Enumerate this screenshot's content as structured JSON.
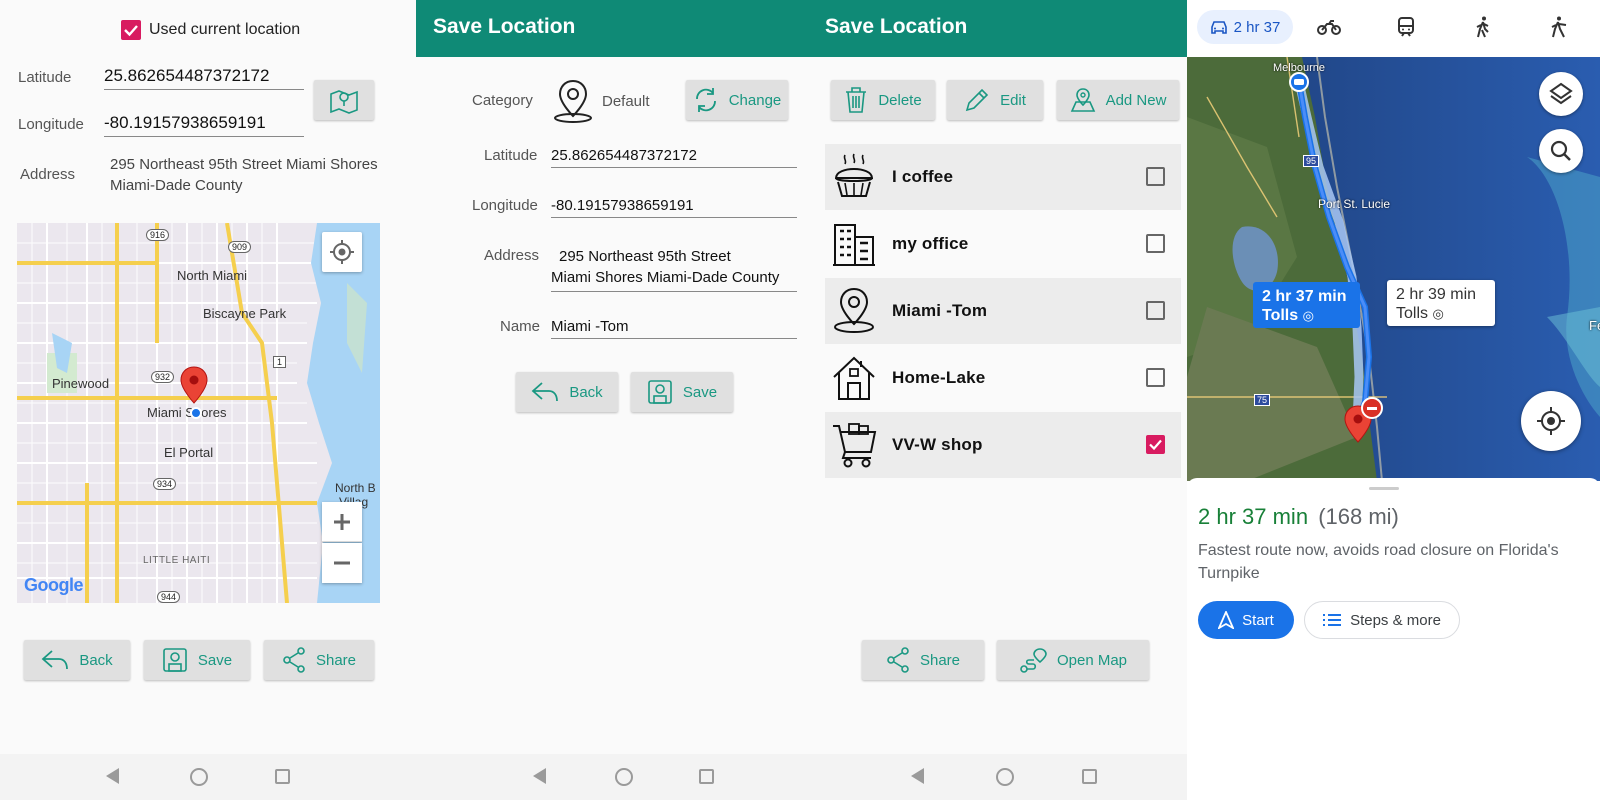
{
  "screen1": {
    "use_current_label": "Used current location",
    "use_current_checked": true,
    "latitude_label": "Latitude",
    "latitude_value": "25.862654487372172",
    "longitude_label": "Longitude",
    "longitude_value": "-80.19157938659191",
    "address_label": "Address",
    "address_value": "295  Northeast 95th Street  Miami Shores  Miami-Dade County",
    "map": {
      "places": [
        "North Miami",
        "Biscayne Park",
        "Pinewood",
        "Miami Shores",
        "El Portal",
        "North B",
        "Villag",
        "LITTLE HAITI"
      ],
      "shields": [
        "916",
        "909",
        "932",
        "1",
        "934",
        "944"
      ],
      "logo": "Google"
    },
    "buttons": {
      "back": "Back",
      "save": "Save",
      "share": "Share"
    }
  },
  "screen2": {
    "title": "Save Location",
    "category_label": "Category",
    "category_value": "Default",
    "change_button": "Change",
    "latitude_label": "Latitude",
    "latitude_value": "25.862654487372172",
    "longitude_label": "Longitude",
    "longitude_value": "-80.19157938659191",
    "address_label": "Address",
    "address_line1": "295  Northeast 95th Street",
    "address_line2": "Miami Shores  Miami-Dade County",
    "name_label": "Name",
    "name_value": "Miami -Tom",
    "buttons": {
      "back": "Back",
      "save": "Save"
    }
  },
  "screen3": {
    "title": "Save Location",
    "toolbar": {
      "delete": "Delete",
      "edit": "Edit",
      "add_new": "Add New"
    },
    "locations": [
      {
        "name": "I coffee",
        "icon": "pie-icon",
        "checked": false
      },
      {
        "name": "my office",
        "icon": "building-icon",
        "checked": false
      },
      {
        "name": "Miami -Tom",
        "icon": "map-pin-icon",
        "checked": false
      },
      {
        "name": "Home-Lake",
        "icon": "house-icon",
        "checked": false
      },
      {
        "name": "VV-W shop",
        "icon": "cart-icon",
        "checked": true
      }
    ],
    "buttons": {
      "share": "Share",
      "open_map": "Open Map"
    }
  },
  "screen4": {
    "modes": [
      {
        "label": "2 hr 37",
        "icon": "car-icon"
      },
      {
        "icon": "motorcycle-icon"
      },
      {
        "icon": "transit-icon"
      },
      {
        "icon": "walk-icon"
      },
      {
        "icon": "bike-icon"
      }
    ],
    "map": {
      "places": [
        "Melbourne",
        "Port St. Lucie"
      ],
      "shields": [
        "95",
        "75"
      ],
      "route_primary": {
        "time": "2 hr 37 min",
        "note": "Tolls"
      },
      "route_alt": {
        "time": "2 hr 39 min",
        "note": "Tolls"
      },
      "edge_label": "Fe"
    },
    "summary": {
      "time": "2 hr 37 min",
      "distance": "(168 mi)",
      "description": "Fastest route now, avoids road closure on Florida's Turnpike"
    },
    "buttons": {
      "start": "Start",
      "steps": "Steps & more"
    },
    "colors": {
      "time_green": "#188038",
      "blue": "#1a73e8"
    }
  }
}
